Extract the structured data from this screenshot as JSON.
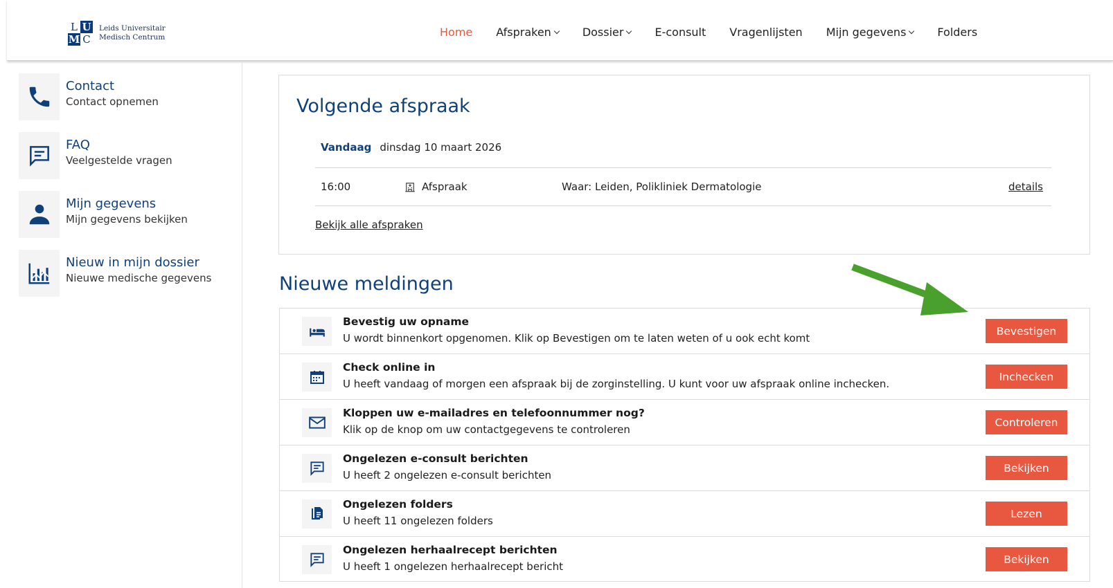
{
  "logo": {
    "letters": [
      "L",
      "U",
      "M",
      "C"
    ],
    "line1": "Leids Universitair",
    "line2": "Medisch Centrum"
  },
  "nav": [
    {
      "label": "Home",
      "active": true,
      "dropdown": false
    },
    {
      "label": "Afspraken",
      "active": false,
      "dropdown": true
    },
    {
      "label": "Dossier",
      "active": false,
      "dropdown": true
    },
    {
      "label": "E-consult",
      "active": false,
      "dropdown": false
    },
    {
      "label": "Vragenlijsten",
      "active": false,
      "dropdown": false
    },
    {
      "label": "Mijn gegevens",
      "active": false,
      "dropdown": true
    },
    {
      "label": "Folders",
      "active": false,
      "dropdown": false
    }
  ],
  "sidebar": [
    {
      "title": "Contact",
      "sub": "Contact opnemen",
      "icon": "phone-icon"
    },
    {
      "title": "FAQ",
      "sub": "Veelgestelde vragen",
      "icon": "chat-icon"
    },
    {
      "title": "Mijn gegevens",
      "sub": "Mijn gegevens bekijken",
      "icon": "user-icon"
    },
    {
      "title": "Nieuw in mijn dossier",
      "sub": "Nieuwe medische gegevens",
      "icon": "chart-icon"
    }
  ],
  "appointment": {
    "heading": "Volgende afspraak",
    "day_label": "Vandaag",
    "date": "dinsdag 10 maart 2026",
    "time": "16:00",
    "type": "Afspraak",
    "location": "Waar: Leiden, Polikliniek Dermatologie",
    "details_link": "details",
    "all_link": "Bekijk alle afspraken"
  },
  "notifications_heading": "Nieuwe meldingen",
  "notifications": [
    {
      "title": "Bevestig uw opname",
      "desc": "U wordt binnenkort opgenomen. Klik op Bevestigen om te laten weten of u ook echt komt",
      "button": "Bevestigen",
      "icon": "bed-icon"
    },
    {
      "title": "Check online in",
      "desc": "U heeft vandaag of morgen een afspraak bij de zorginstelling. U kunt voor uw afspraak online inchecken.",
      "button": "Inchecken",
      "icon": "calendar-icon"
    },
    {
      "title": "Kloppen uw e-mailadres en telefoonnummer nog?",
      "desc": "Klik op de knop om uw contactgegevens te controleren",
      "button": "Controleren",
      "icon": "envelope-icon"
    },
    {
      "title": "Ongelezen e-consult berichten",
      "desc": "U heeft 2 ongelezen e-consult berichten",
      "button": "Bekijken",
      "icon": "chat-icon"
    },
    {
      "title": "Ongelezen folders",
      "desc": "U heeft 11 ongelezen folders",
      "button": "Lezen",
      "icon": "documents-icon"
    },
    {
      "title": "Ongelezen herhaalrecept berichten",
      "desc": "U heeft 1 ongelezen herhaalrecept bericht",
      "button": "Bekijken",
      "icon": "chat-icon"
    }
  ],
  "colors": {
    "accent": "#e8573f",
    "brand": "#10407a",
    "arrow": "#4aa02c"
  }
}
